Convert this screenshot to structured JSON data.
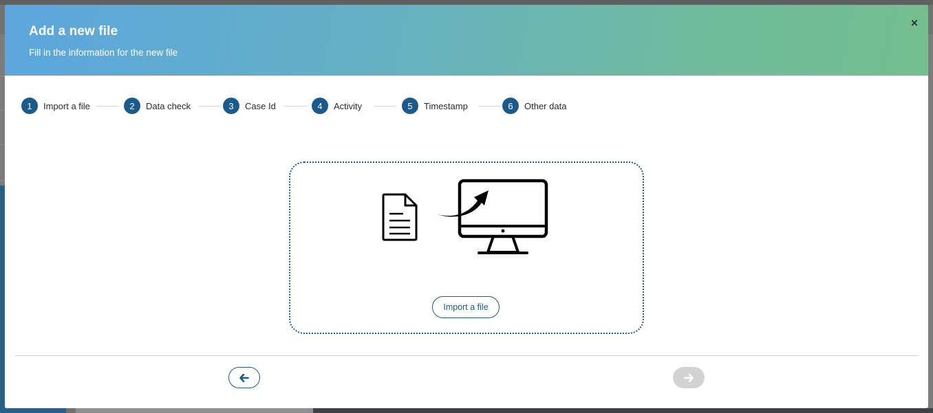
{
  "modal": {
    "title": "Add a new file",
    "subtitle": "Fill in the information for the new file",
    "close_label": "×"
  },
  "steps": [
    {
      "number": "1",
      "label": "Import a file"
    },
    {
      "number": "2",
      "label": "Data check"
    },
    {
      "number": "3",
      "label": "Case Id"
    },
    {
      "number": "4",
      "label": "Activity"
    },
    {
      "number": "5",
      "label": "Timestamp"
    },
    {
      "number": "6",
      "label": "Other data"
    }
  ],
  "dropzone": {
    "illustration_icons": [
      "document-icon",
      "upload-arrow-icon",
      "monitor-icon"
    ],
    "import_button_label": "Import a file"
  },
  "footer": {
    "prev_icon": "arrow-left-icon",
    "next_icon": "arrow-right-icon",
    "next_enabled": false
  },
  "colors": {
    "accent": "#1b5a8c",
    "header_gradient_start": "#5ba6de",
    "header_gradient_end": "#74bf8e",
    "disabled": "#d3d3d3"
  }
}
